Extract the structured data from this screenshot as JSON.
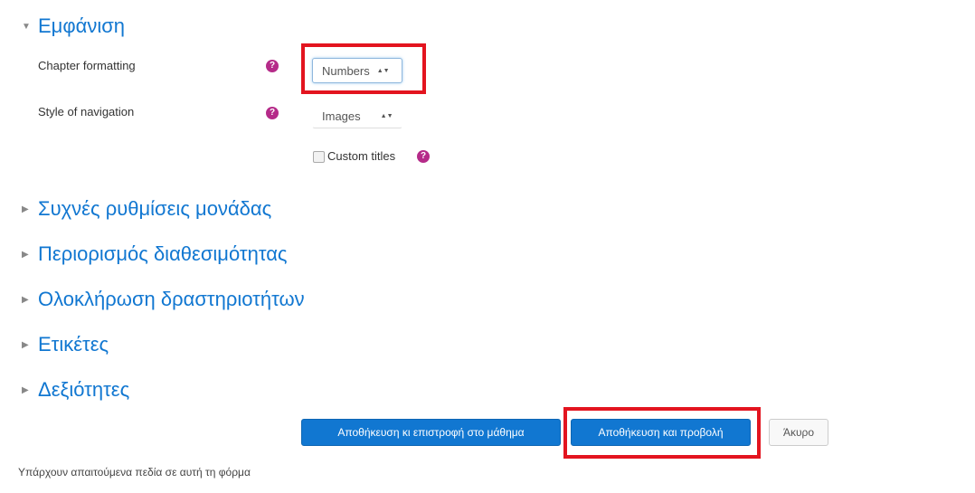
{
  "sections": {
    "appearance": {
      "title": "Εμφάνιση"
    },
    "common_settings": {
      "title": "Συχνές ρυθμίσεις μονάδας"
    },
    "restrictions": {
      "title": "Περιορισμός διαθεσιμότητας"
    },
    "completion": {
      "title": "Ολοκλήρωση δραστηριοτήτων"
    },
    "tags": {
      "title": "Ετικέτες"
    },
    "competencies": {
      "title": "Δεξιότητες"
    }
  },
  "form": {
    "chapter_formatting": {
      "label": "Chapter formatting",
      "value": "Numbers"
    },
    "style_navigation": {
      "label": "Style of navigation",
      "value": "Images"
    },
    "custom_titles": {
      "label": "Custom titles",
      "checked": false
    }
  },
  "buttons": {
    "save_return": "Αποθήκευση κι επιστροφή στο μάθημα",
    "save_display": "Αποθήκευση και προβολή",
    "cancel": "Άκυρο"
  },
  "footer": {
    "required_note": "Υπάρχουν απαιτούμενα πεδία σε αυτή τη φόρμα"
  },
  "colors": {
    "link_blue": "#1177d1",
    "highlight_red": "#e3141f",
    "help_magenta": "#b52b89"
  },
  "icons": {
    "expanded": "caret-down-icon",
    "collapsed": "caret-right-icon",
    "help": "question-circle-icon"
  }
}
